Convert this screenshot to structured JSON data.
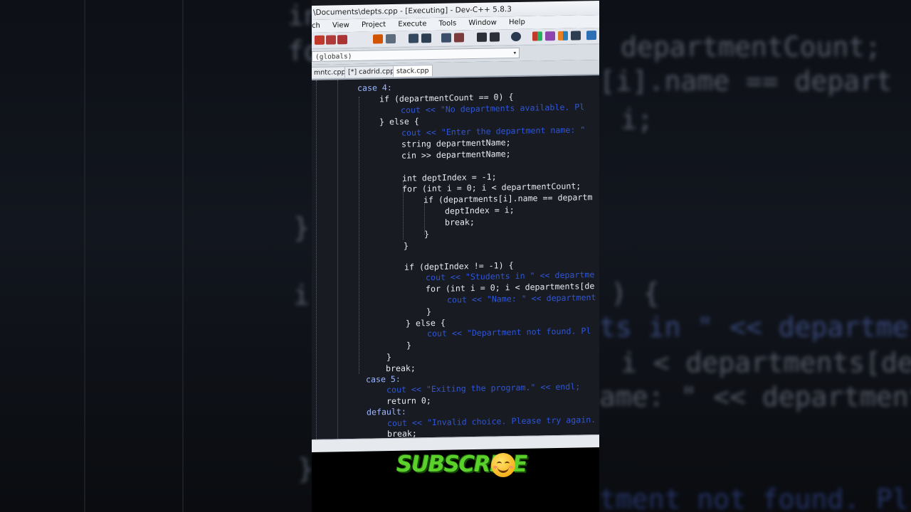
{
  "window": {
    "title": "\\Documents\\depts.cpp - [Executing] - Dev-C++ 5.8.3"
  },
  "menu": {
    "items": [
      "ch",
      "View",
      "Project",
      "Execute",
      "Tools",
      "Window",
      "Help"
    ]
  },
  "scope": {
    "value": "(globals)"
  },
  "tabs": [
    "mntc.cpp",
    "[*] cadrid.cpp",
    "stack.cpp"
  ],
  "code": {
    "lines": [
      "case 4:",
      "if (departmentCount == 0) {",
      "cout << \"No departments available. Pl",
      "} else {",
      "cout << \"Enter the department name: \"",
      "string departmentName;",
      "cin >> departmentName;",
      "int deptIndex = -1;",
      "for (int i = 0; i < departmentCount;",
      "if (departments[i].name == departm",
      "deptIndex = i;",
      "break;",
      "}",
      "}",
      "if (deptIndex != -1) {",
      "cout << \"Students in \" << departme",
      "for (int i = 0; i < departments[de",
      "cout << \"Name: \" << department",
      "}",
      "} else {",
      "cout << \"Department not found. Pl",
      "}",
      "}",
      "break;",
      "case 5:",
      "cout << \"Exiting the program.\" << endl;",
      "return 0;",
      "default:",
      "cout << \"Invalid choice. Please try again.",
      "break;"
    ]
  },
  "background": {
    "left_fragments": [
      "in",
      "fo",
      "}",
      "i",
      "}"
    ],
    "right_fragments": [
      "departmentCount;",
      "[i].name == depart",
      "i;",
      ") {",
      "ts in \" << departme",
      "i < departments[de",
      "ame: \" << department",
      "tment not found. Pl"
    ]
  },
  "overlay": {
    "subscribe_text": "SUBSCRIBE"
  }
}
